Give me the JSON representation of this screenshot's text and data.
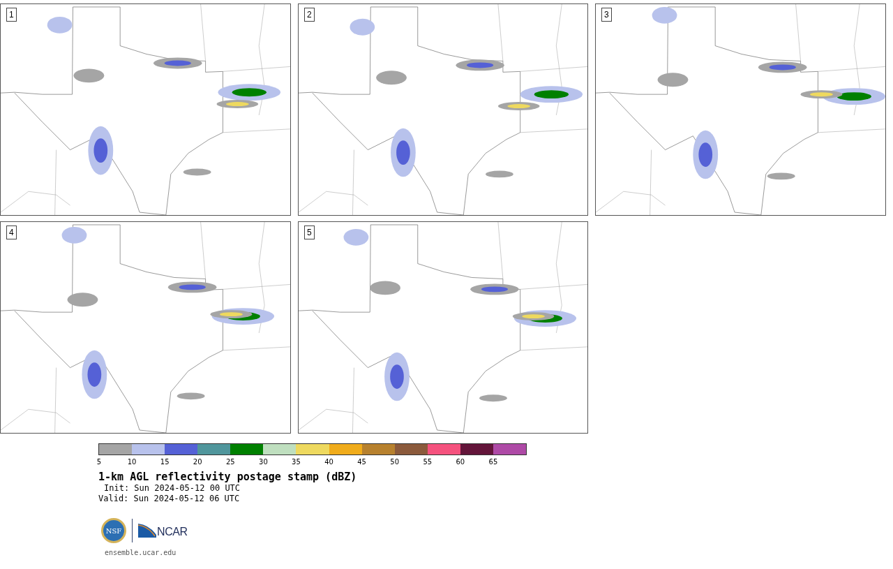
{
  "panels": [
    {
      "label": "1"
    },
    {
      "label": "2"
    },
    {
      "label": "3"
    },
    {
      "label": "4"
    },
    {
      "label": "5"
    }
  ],
  "colorbar": {
    "bins": [
      {
        "color": "#a5a5a5"
      },
      {
        "color": "#b8c2ec"
      },
      {
        "color": "#5561d6"
      },
      {
        "color": "#50969c"
      },
      {
        "color": "#008000"
      },
      {
        "color": "#bfdfbf"
      },
      {
        "color": "#eed95f"
      },
      {
        "color": "#f0ac1b"
      },
      {
        "color": "#b7812e"
      },
      {
        "color": "#8b5a3c"
      },
      {
        "color": "#f5527e"
      },
      {
        "color": "#63153a"
      },
      {
        "color": "#ae4aa6"
      }
    ],
    "ticks": [
      "5",
      "10",
      "15",
      "20",
      "25",
      "30",
      "35",
      "40",
      "45",
      "50",
      "55",
      "60",
      "65"
    ]
  },
  "title": "1-km AGL reflectivity postage stamp (dBZ)",
  "init": "Init: Sun 2024-05-12 00 UTC",
  "valid": "Valid: Sun 2024-05-12 06 UTC",
  "logos": {
    "nsf": "NSF",
    "ncar": "NCAR"
  },
  "footer": "ensemble.ucar.edu"
}
